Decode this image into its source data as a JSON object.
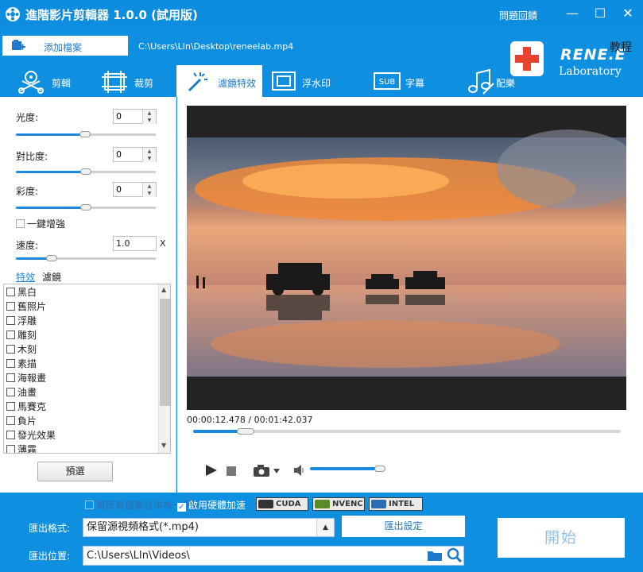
{
  "window": {
    "title": "進階影片剪輯器 1.0.0 (試用版)",
    "help_link": "問題回饋",
    "minimize": "—",
    "maximize": "☐",
    "close": "✕"
  },
  "toolbar": {
    "add_file_label": "添加檔案",
    "file_path": "C:\\Users\\LIn\\Desktop\\reneelab.mp4"
  },
  "brand": {
    "logo_text": "RENE.E",
    "logo_sub": "Laboratory",
    "tutorial_label": "教程",
    "accent_color": "#0f8fe0",
    "logo_cross_color": "#e8432e"
  },
  "tabs": [
    {
      "label": "剪輯",
      "icon": "scissors-reel-icon"
    },
    {
      "label": "裁剪",
      "icon": "crop-icon"
    },
    {
      "label": "濾鏡特效",
      "icon": "magic-wand-icon",
      "active": true
    },
    {
      "label": "浮水印",
      "icon": "watermark-icon"
    },
    {
      "label": "字幕",
      "icon": "subtitle-icon"
    },
    {
      "label": "配樂",
      "icon": "music-note-icon"
    }
  ],
  "adjust": {
    "brightness_label": "光度:",
    "brightness_value": "0",
    "contrast_label": "對比度:",
    "contrast_value": "0",
    "saturation_label": "彩度:",
    "saturation_value": "0",
    "auto_enhance_label": "一鍵增強",
    "speed_label": "速度:",
    "speed_value": "1.0",
    "speed_unit": "X",
    "brightness_level": 0.5,
    "contrast_level": 0.5,
    "saturation_level": 0.5,
    "speed_level": 0.25
  },
  "effects": {
    "tab_effects": "特效",
    "tab_filters": "濾鏡",
    "items": [
      "黑白",
      "舊照片",
      "浮雕",
      "雕刻",
      "木刻",
      "素描",
      "海報畫",
      "油畫",
      "馬賽克",
      "負片",
      "發光效果",
      "薄霧"
    ],
    "preset_button": "預選"
  },
  "player": {
    "time_current": "00:00:12.478",
    "time_total": "00:01:42.037",
    "progress": 0.122,
    "volume": 0.8
  },
  "output": {
    "merge_label": "將所有檔案合併為一個影片",
    "hw_accel_label": "啟用硬體加速",
    "hw_accel_checked": true,
    "badges": [
      "CUDA",
      "NVENC",
      "INTEL"
    ],
    "format_label": "匯出格式:",
    "format_value": "保留源視頻格式(*.mp4)",
    "settings_button": "匯出設定",
    "path_label": "匯出位置:",
    "path_value": "C:\\Users\\LIn\\Videos\\",
    "start_button": "開始"
  }
}
